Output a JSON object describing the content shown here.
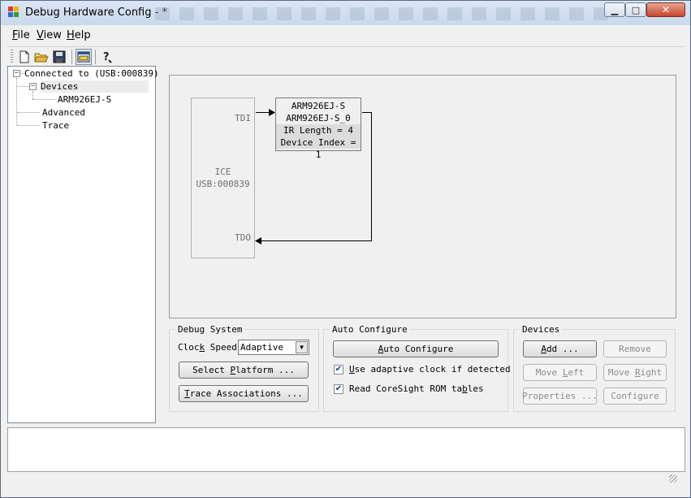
{
  "window": {
    "title": "Debug Hardware Config -  *",
    "min_glyph": "▁",
    "max_glyph": "□",
    "close_glyph": "✕"
  },
  "menu": [
    {
      "pre": "",
      "u": "F",
      "post": "ile"
    },
    {
      "pre": "",
      "u": "V",
      "post": "iew"
    },
    {
      "pre": "",
      "u": "H",
      "post": "elp"
    }
  ],
  "toolbar": {
    "icons": [
      "new-file-icon",
      "open-folder-icon",
      "save-icon",
      "layout-view-icon",
      "help-icon"
    ]
  },
  "tree": {
    "root": "Connected to (USB:000839)",
    "devices": "Devices",
    "device_child": "ARM926EJ-S",
    "advanced": "Advanced",
    "trace": "Trace",
    "collapse_glyph": "−"
  },
  "diagram": {
    "ice_name": "ICE",
    "ice_id": "USB:000839",
    "tdi": "TDI",
    "tdo": "TDO",
    "device_lines": [
      "ARM926EJ-S",
      "ARM926EJ-S_0",
      "IR Length = 4",
      "Device Index = 1"
    ]
  },
  "debug_system": {
    "title": "Debug System",
    "clock_label_pre": "Cloc",
    "clock_label_u": "k",
    "clock_label_post": " Speed",
    "clock_value": "Adaptive",
    "select_platform": {
      "pre": "Select ",
      "u": "P",
      "post": "latform ..."
    },
    "trace_assoc": {
      "pre": "",
      "u": "T",
      "post": "race Associations ..."
    }
  },
  "auto_configure": {
    "title": "Auto Configure",
    "button": {
      "pre": "",
      "u": "A",
      "post": "uto Configure"
    },
    "opt1": {
      "pre": "",
      "u": "U",
      "post": "se adaptive clock if detected",
      "checked": true
    },
    "opt2": {
      "pre": "Read CoreSight ROM ta",
      "u": "b",
      "post": "les",
      "checked": true
    },
    "check_glyph": "✔"
  },
  "devices_panel": {
    "title": "Devices",
    "add": {
      "pre": "",
      "u": "A",
      "post": "dd ..."
    },
    "remove": {
      "pre": "Remove",
      "u": "",
      "post": ""
    },
    "move_left": {
      "pre": "Move ",
      "u": "L",
      "post": "eft"
    },
    "move_right": {
      "pre": "Move ",
      "u": "R",
      "post": "ight"
    },
    "properties": {
      "pre": "Properties ...",
      "u": "",
      "post": ""
    },
    "configure": {
      "pre": "Configure",
      "u": "",
      "post": ""
    }
  },
  "colors": {
    "wire": "#000000",
    "ice_text": "#6e6e6e",
    "disabled_text": "#8a8a8a"
  }
}
